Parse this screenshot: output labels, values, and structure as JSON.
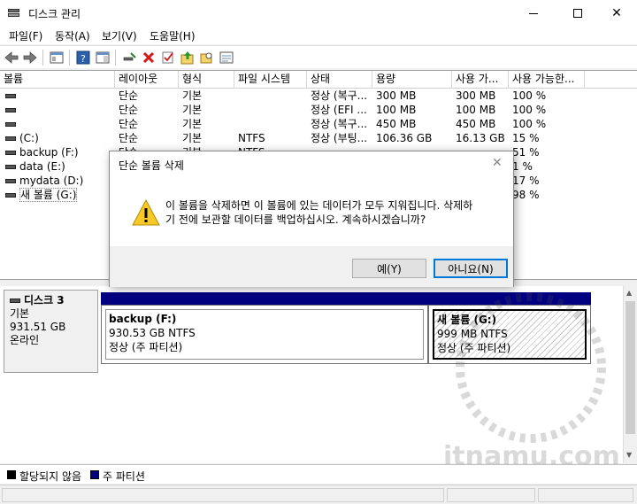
{
  "window": {
    "title": "디스크 관리"
  },
  "menu": [
    "파일(F)",
    "동작(A)",
    "보기(V)",
    "도움말(H)"
  ],
  "toolbar_icons": [
    "back-icon",
    "forward-icon",
    "properties-icon",
    "help-icon",
    "console-icon",
    "connect-icon",
    "delete-icon",
    "check-icon",
    "folder-up-icon",
    "search-folder-icon",
    "list-icon"
  ],
  "volume_columns": [
    "볼륨",
    "레이아웃",
    "형식",
    "파일 시스템",
    "상태",
    "용량",
    "사용 가...",
    "사용 가능한..."
  ],
  "volumes": [
    {
      "name": "",
      "layout": "단순",
      "type": "기본",
      "fs": "",
      "status": "정상 (복구...",
      "capacity": "300 MB",
      "free": "300 MB",
      "pct": "100 %"
    },
    {
      "name": "",
      "layout": "단순",
      "type": "기본",
      "fs": "",
      "status": "정상 (EFI ...",
      "capacity": "100 MB",
      "free": "100 MB",
      "pct": "100 %"
    },
    {
      "name": "",
      "layout": "단순",
      "type": "기본",
      "fs": "",
      "status": "정상 (복구...",
      "capacity": "450 MB",
      "free": "450 MB",
      "pct": "100 %"
    },
    {
      "name": "(C:)",
      "layout": "단순",
      "type": "기본",
      "fs": "NTFS",
      "status": "정상 (부팅...",
      "capacity": "106.36 GB",
      "free": "16.13 GB",
      "pct": "15 %"
    },
    {
      "name": "backup (F:)",
      "layout": "단순",
      "type": "기본",
      "fs": "NTFS",
      "status": "",
      "capacity": "",
      "free": "",
      "pct": "51 %"
    },
    {
      "name": "data (E:)",
      "layout": "",
      "type": "",
      "fs": "",
      "status": "",
      "capacity": "",
      "free": "",
      "pct": "1 %"
    },
    {
      "name": "mydata (D:)",
      "layout": "",
      "type": "",
      "fs": "",
      "status": "",
      "capacity": "",
      "free": "",
      "pct": "17 %"
    },
    {
      "name": "새 볼륨 (G:)",
      "layout": "",
      "type": "",
      "fs": "",
      "status": "",
      "capacity": "",
      "free": "",
      "pct": "98 %"
    }
  ],
  "disk": {
    "title": "디스크 3",
    "type": "기본",
    "size": "931.51 GB",
    "state": "온라인",
    "partitions": [
      {
        "name": "backup  (F:)",
        "size": "930.53 GB NTFS",
        "status": "정상 (주 파티션)"
      },
      {
        "name": "새 볼륨  (G:)",
        "size": "999 MB NTFS",
        "status": "정상 (주 파티션)"
      }
    ]
  },
  "legend": [
    {
      "label": "할당되지 않음",
      "color": "#000000"
    },
    {
      "label": "주 파티션",
      "color": "#000080"
    }
  ],
  "dialog": {
    "title": "단순 볼륨 삭제",
    "message_line1": "이 볼륨을 삭제하면 이 볼륨에 있는 데이터가 모두 지워집니다. 삭제하",
    "message_line2": "기 전에 보관할 데이터를 백업하십시오. 계속하시겠습니까?",
    "yes_label": "예(Y)",
    "no_label": "아니요(N)"
  },
  "watermark_text": "itnamu.com"
}
